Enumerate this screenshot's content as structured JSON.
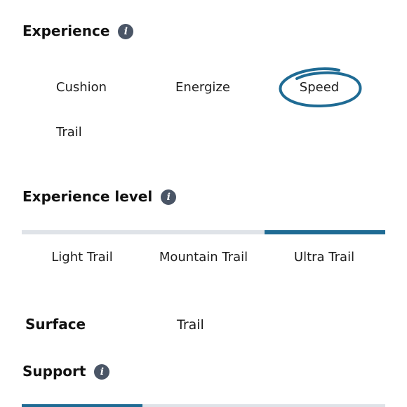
{
  "experience": {
    "title": "Experience",
    "info_glyph": "i",
    "options": [
      "Cushion",
      "Energize",
      "Speed",
      "Trail"
    ],
    "selected": "Speed",
    "highlight_color": "#1f6b94"
  },
  "experience_level": {
    "title": "Experience level",
    "info_glyph": "i",
    "options": [
      "Light Trail",
      "Mountain Trail",
      "Ultra Trail"
    ],
    "selected": "Ultra Trail",
    "level_fraction_start": 0.667,
    "level_fraction_end": 1.0,
    "track_color": "#dfe3e8",
    "fill_color": "#1f6b94"
  },
  "surface": {
    "label": "Surface",
    "value": "Trail"
  },
  "support": {
    "title": "Support",
    "info_glyph": "i",
    "level_fraction_start": 0.0,
    "level_fraction_end": 0.333
  }
}
